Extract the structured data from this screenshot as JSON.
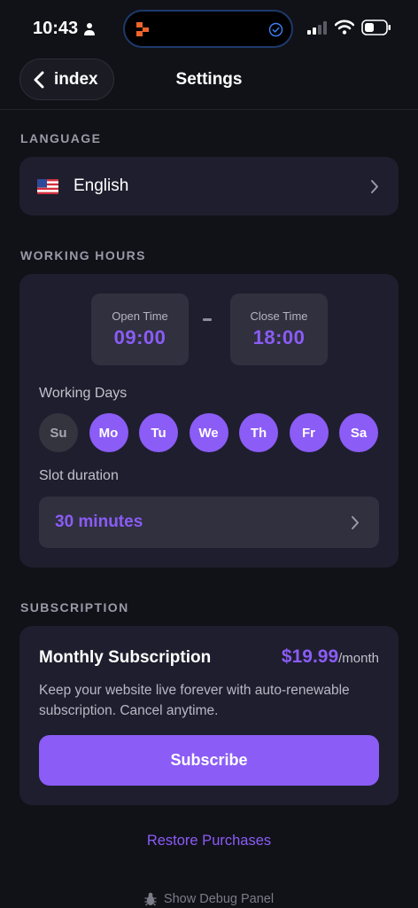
{
  "status_bar": {
    "time": "10:43",
    "icons": [
      "person-icon",
      "app-logo-icon",
      "check-circle-icon",
      "signal-icon",
      "wifi-icon",
      "battery-icon"
    ]
  },
  "nav": {
    "back_label": "index",
    "title": "Settings"
  },
  "language": {
    "section_label": "LANGUAGE",
    "flag_icon": "us-flag-icon",
    "value": "English"
  },
  "working_hours": {
    "section_label": "WORKING HOURS",
    "open_label": "Open Time",
    "open_value": "09:00",
    "close_label": "Close Time",
    "close_value": "18:00",
    "days_label": "Working Days",
    "days": [
      {
        "label": "Su",
        "active": false
      },
      {
        "label": "Mo",
        "active": true
      },
      {
        "label": "Tu",
        "active": true
      },
      {
        "label": "We",
        "active": true
      },
      {
        "label": "Th",
        "active": true
      },
      {
        "label": "Fr",
        "active": true
      },
      {
        "label": "Sa",
        "active": true
      }
    ],
    "slot_label": "Slot duration",
    "slot_value": "30 minutes"
  },
  "subscription": {
    "section_label": "SUBSCRIPTION",
    "plan_title": "Monthly Subscription",
    "price": "$19.99",
    "period": "/month",
    "description": "Keep your website live forever with auto-renewable subscription. Cancel anytime.",
    "button_label": "Subscribe"
  },
  "footer": {
    "restore_label": "Restore Purchases",
    "debug_label": "Show Debug Panel"
  },
  "colors": {
    "background": "#111118",
    "card": "#1e1e2e",
    "accent": "#8b5cf6",
    "muted_text": "#9a9aa8"
  }
}
